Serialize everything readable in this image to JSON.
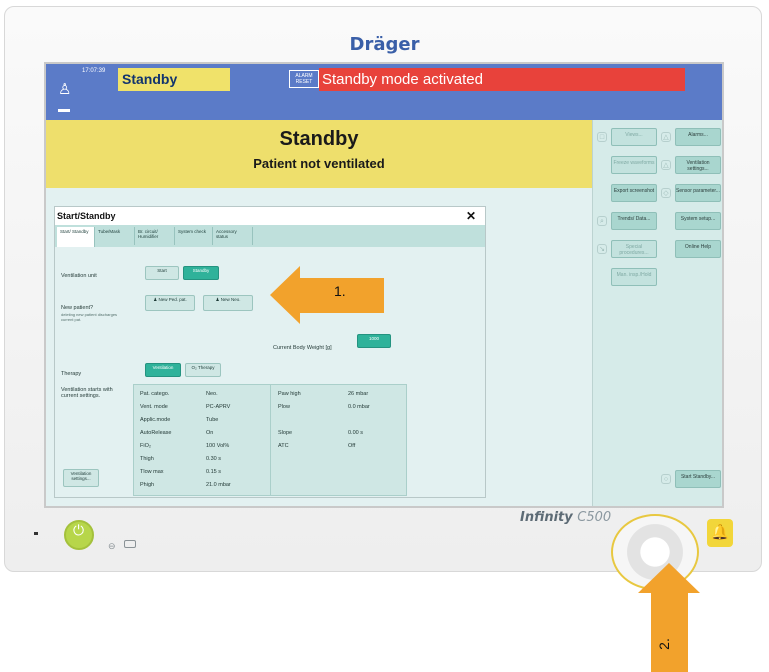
{
  "brand": "Dräger",
  "model": {
    "name": "Infinity",
    "suffix": "C500"
  },
  "header": {
    "time": "17:07:39",
    "status": "Standby",
    "alarm_reset": "ALARM RESET",
    "alarm_message": "Standby mode activated"
  },
  "banner": {
    "title": "Standby",
    "subtitle": "Patient not ventilated"
  },
  "right_col": {
    "left_buttons": [
      "Views...",
      "Freeze waveforms",
      "Export screenshot",
      "Trends/ Data...",
      "Special procedures...",
      "Man. insp./Hold"
    ],
    "right_buttons": [
      "Alarms...",
      "Ventilation settings...",
      "Sensor parameter...",
      "System setup...",
      "Online Help",
      "Start Standby..."
    ]
  },
  "dialog": {
    "title": "Start/Standby",
    "close": "✕",
    "tabs": [
      "Start/ Standby",
      "Tube/Mask",
      "Br. circuit/ Humidifier",
      "System check",
      "Accessory status"
    ],
    "ventilation_unit_label": "Ventilation unit",
    "start_btn": "Start",
    "standby_btn": "Standby",
    "new_patient_label": "New patient?",
    "new_patient_sub": "deleting new patient discharges current pat.",
    "new_patient_btn": "New Ped. pat.",
    "new_neo_btn": "New Neo.",
    "body_weight_label": "Current Body Weight [g]",
    "body_weight_value": "1000",
    "therapy_label": "Therapy",
    "therapy_ventilation": "Ventilation",
    "therapy_o2": "O₂ Therapy",
    "vent_starts_label": "Ventilation starts with current settings.",
    "vent_settings_btn": "Ventilation settings...",
    "params_left": [
      {
        "name": "Pat. catego.",
        "value": "Neo."
      },
      {
        "name": "Vent. mode",
        "value": "PC-APRV"
      },
      {
        "name": "Applic.mode",
        "value": "Tube"
      },
      {
        "name": "AutoRelease",
        "value": "On"
      },
      {
        "name": "FiO₂",
        "value": "100 Vol%"
      },
      {
        "name": "Thigh",
        "value": "0.30 s"
      },
      {
        "name": "Tlow max",
        "value": "0.15 s"
      },
      {
        "name": "Phigh",
        "value": "21.0 mbar"
      }
    ],
    "params_right": [
      {
        "name": "Paw high",
        "value": "26 mbar"
      },
      {
        "name": "Plow",
        "value": "0.0 mbar"
      },
      {
        "name": "Slope",
        "value": "0.00 s"
      },
      {
        "name": "ATC",
        "value": "Off"
      }
    ]
  },
  "callouts": {
    "one": "1.",
    "two": "2."
  },
  "colors": {
    "header": "#5b7bc8",
    "status_yellow": "#eedf6c",
    "alarm_red": "#e8423b",
    "arrow_orange": "#f2a22c",
    "active_button": "#2fb29a"
  }
}
